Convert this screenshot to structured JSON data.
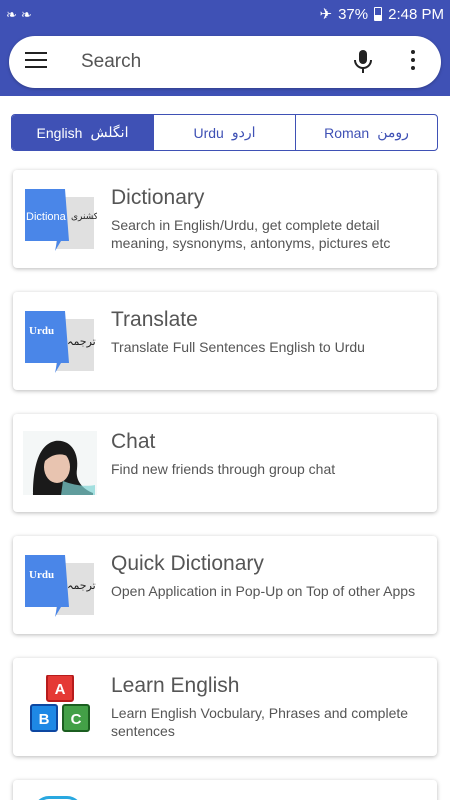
{
  "status_bar": {
    "left_icons": [
      "notification-icon",
      "notification-icon"
    ],
    "battery": "37%",
    "time": "2:48 PM"
  },
  "search": {
    "placeholder": "Search"
  },
  "language_tabs": [
    {
      "label": "English",
      "native": "انگلش",
      "active": true
    },
    {
      "label": "Urdu",
      "native": "اردو",
      "active": false
    },
    {
      "label": "Roman",
      "native": "رومن",
      "active": false
    }
  ],
  "features": [
    {
      "title": "Dictionary",
      "description": "Search in English/Urdu, get complete detail meaning, sysnonyms, antonyms, pictures etc",
      "icon": "dictionary-icon",
      "thumb_en": "Dictiona",
      "thumb_ur": "ڈکشنری"
    },
    {
      "title": "Translate",
      "description": "Translate Full Sentences English to Urdu",
      "icon": "translate-icon",
      "thumb_en": "Urdu",
      "thumb_ur": "ترجمہ"
    },
    {
      "title": "Chat",
      "description": "Find new friends through group chat",
      "icon": "chat-avatar-icon"
    },
    {
      "title": "Quick Dictionary",
      "description": "Open Application in Pop-Up on Top of other Apps",
      "icon": "quick-dictionary-icon",
      "thumb_en": "Urdu",
      "thumb_ur": "ترجمہ"
    },
    {
      "title": "Learn English",
      "description": "Learn English Vocbulary, Phrases and complete sentences",
      "icon": "abc-blocks-icon",
      "blocks": [
        "A",
        "B",
        "C"
      ]
    }
  ],
  "colors": {
    "primary": "#3f51b5",
    "card_blue": "#4a86e8",
    "block_red": "#e53935",
    "block_blue": "#1e88e5",
    "block_green": "#43a047"
  }
}
